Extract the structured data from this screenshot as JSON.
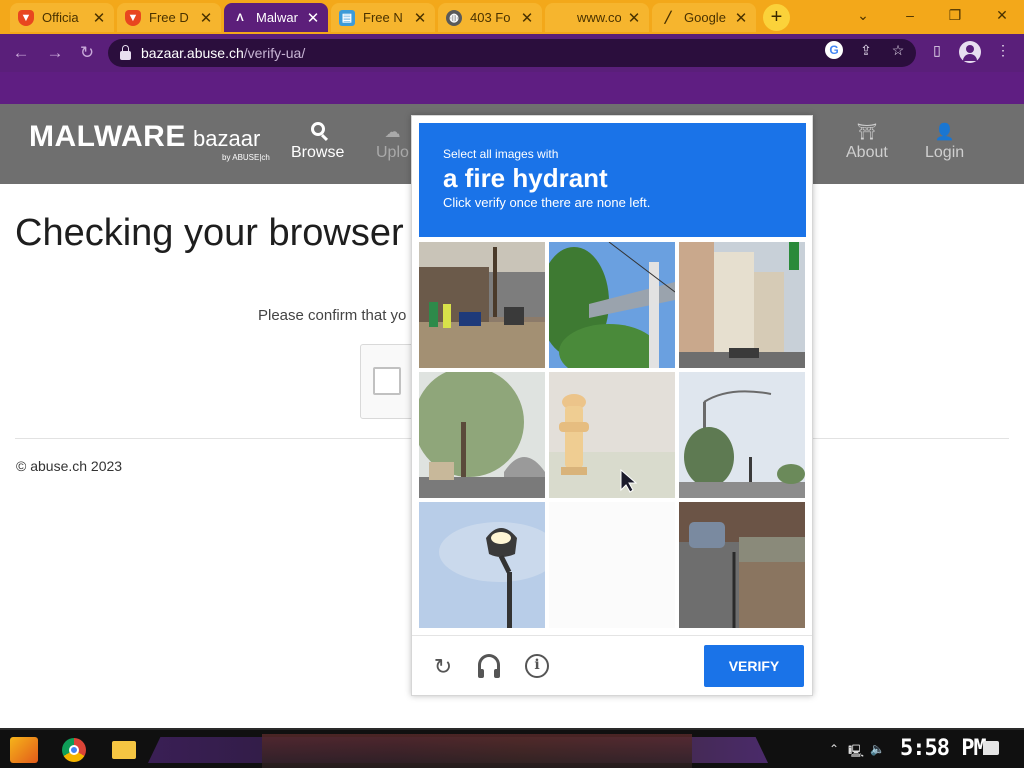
{
  "browser": {
    "tabs": [
      {
        "title": "Officia",
        "favicon": "brave-lion-icon"
      },
      {
        "title": "Free D",
        "favicon": "brave-lion-icon"
      },
      {
        "title": "Malwar",
        "favicon": "malwarebazaar-icon",
        "active": true
      },
      {
        "title": "Free N",
        "favicon": "website-icon"
      },
      {
        "title": "403 Fo",
        "favicon": "globe-icon"
      },
      {
        "title": "www.co",
        "favicon": ""
      },
      {
        "title": "Google",
        "favicon": "google-docs-icon"
      }
    ],
    "new_tab_label": "+",
    "address": {
      "host": "bazaar.abuse.ch",
      "path": "/verify-ua/"
    },
    "theme_color": "#5a1f7a",
    "tabstrip_color": "#f3a81a"
  },
  "site": {
    "brand": {
      "name": "MALWARE",
      "sub": "bazaar",
      "byline": "by ABUSE|ch"
    },
    "nav": {
      "browse": "Browse",
      "upload": "Uplo",
      "about": "About",
      "login": "Login"
    },
    "heading": "Checking your browser",
    "confirm_text": "Please confirm that yo",
    "footer": "© abuse.ch 2023"
  },
  "captcha": {
    "instruction_small": "Select all images with",
    "target": "a fire hydrant",
    "hint": "Click verify once there are none left.",
    "verify_label": "VERIFY",
    "tiles": [
      {
        "name": "tile-street-shops"
      },
      {
        "name": "tile-trees-bridge"
      },
      {
        "name": "tile-buildings-street"
      },
      {
        "name": "tile-tree-underpass"
      },
      {
        "name": "tile-fire-hydrant"
      },
      {
        "name": "tile-streetlight-road"
      },
      {
        "name": "tile-street-lamp"
      },
      {
        "name": "tile-blank"
      },
      {
        "name": "tile-parked-car"
      }
    ],
    "accent": "#1a73e8"
  },
  "taskbar": {
    "clock": "5:58 PM"
  }
}
